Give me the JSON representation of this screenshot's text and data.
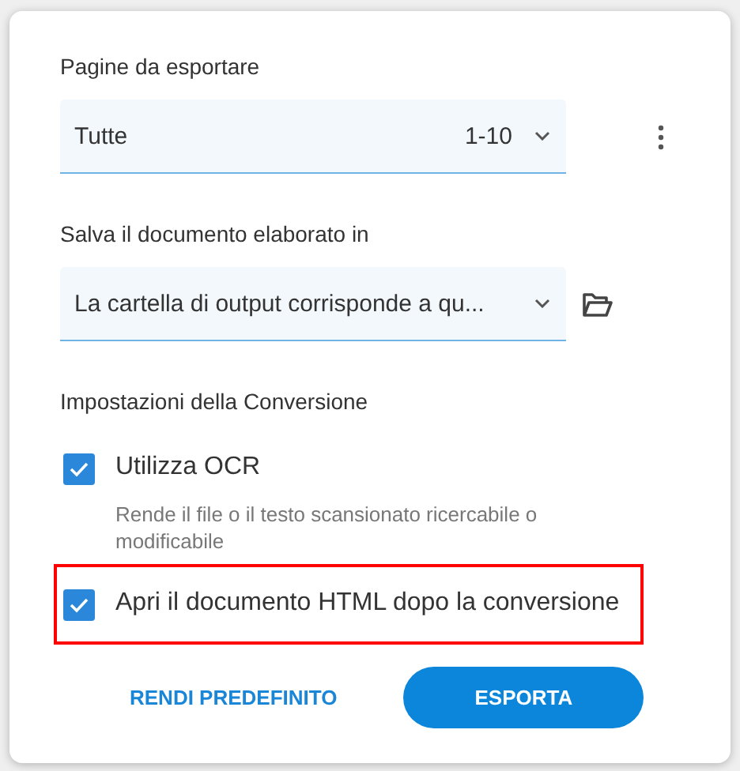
{
  "sections": [
    {
      "kind": "select",
      "label": "Pagine da esportare",
      "field": {
        "value": "Tutte",
        "range": "1-10"
      },
      "side_button": {
        "kind": "more"
      }
    },
    {
      "kind": "select",
      "label": "Salva il documento elaborato in",
      "field": {
        "value": "La cartella di output corrisponde a qu..."
      },
      "side_button": {
        "kind": "folder"
      }
    },
    {
      "kind": "options",
      "label": "Impostazioni della Conversione",
      "options": [
        {
          "label": "Utilizza OCR",
          "checked": true,
          "highlighted": false,
          "description": "Rende il file o il testo scansionato ricercabile o modificabile"
        },
        {
          "label": "Apri il documento HTML dopo la conversione",
          "checked": true,
          "highlighted": true
        }
      ]
    }
  ],
  "buttons": [
    {
      "label": "RENDI PREDEFINITO",
      "kind": "text"
    },
    {
      "label": "ESPORTA",
      "kind": "primary"
    }
  ]
}
